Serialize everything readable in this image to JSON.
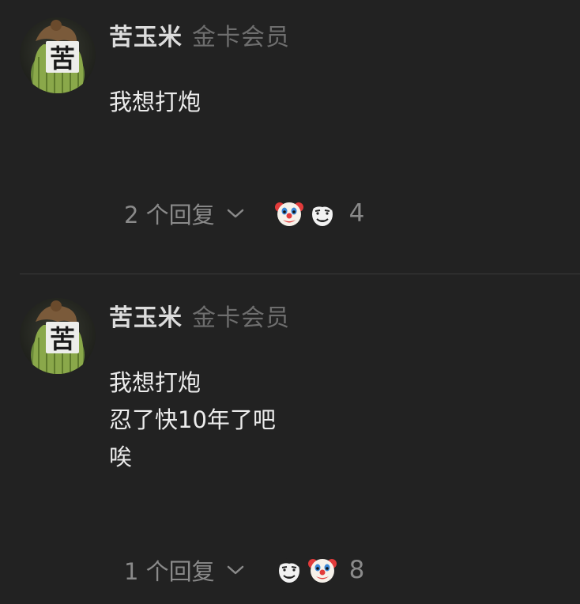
{
  "colors": {
    "background": "#222222",
    "username": "#dcdcdc",
    "badge": "#6e6e6e",
    "text": "#ececec",
    "meta": "#8a8a8a",
    "divider": "#3a3a3a"
  },
  "comments": [
    {
      "username": "苦玉米",
      "badge": "金卡会员",
      "lines": [
        "我想打炮"
      ],
      "replies_label": "2 个回复",
      "reactions": [
        "clown-face-emoji",
        "troll-face-emoji"
      ],
      "reaction_count": "4",
      "avatar_icon": "bitter-corn-avatar",
      "avatar_char": "苦"
    },
    {
      "username": "苦玉米",
      "badge": "金卡会员",
      "lines": [
        "我想打炮",
        "忍了快10年了吧",
        "唉"
      ],
      "replies_label": "1 个回复",
      "reactions": [
        "troll-face-emoji",
        "clown-face-emoji"
      ],
      "reaction_count": "8",
      "avatar_icon": "bitter-corn-avatar",
      "avatar_char": "苦"
    }
  ]
}
